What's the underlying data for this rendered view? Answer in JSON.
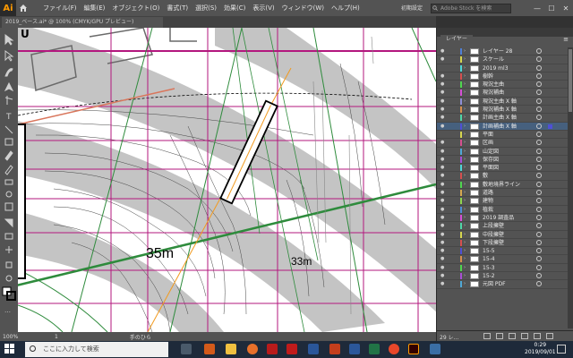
{
  "app": {
    "logo": "Ai",
    "home_icon": "home-icon"
  },
  "menu": {
    "items": [
      "ファイル(F)",
      "編集(E)",
      "オブジェクト(O)",
      "書式(T)",
      "選択(S)",
      "効果(C)",
      "表示(V)",
      "ウィンドウ(W)",
      "ヘルプ(H)"
    ],
    "workspace": "初期設定",
    "search_placeholder": "Adobe Stock を検索"
  },
  "document_tab": {
    "title": "2019_ベース.ai* @ 100% (CMYK/GPU プレビュー)"
  },
  "canvas": {
    "labels": {
      "contour_35": "35m",
      "contour_33": "33m",
      "top_mark": "U"
    },
    "colors": {
      "gray_band": "#c2c2c2",
      "magenta_guide": "#b3177e",
      "green_line": "#2e8b3c",
      "orange_line": "#f29a1e",
      "salmon_line": "#d9765c"
    }
  },
  "status": {
    "zoom": "100%",
    "artboard": "1",
    "tool": "手のひら"
  },
  "layers_panel": {
    "tab": "レイヤー",
    "menu_icon": "≡",
    "layer_count": "29 レ...",
    "layers": [
      {
        "name": "レイヤー 28",
        "color": "#4f7fd6",
        "visible": true,
        "selected": false
      },
      {
        "name": "スケール",
        "color": "#d6d64f",
        "visible": true,
        "selected": false
      },
      {
        "name": "2019 ml3",
        "color": "#4fd6d6",
        "visible": false,
        "selected": false
      },
      {
        "name": "樹幹",
        "color": "#d64f4f",
        "visible": true,
        "selected": false
      },
      {
        "name": "現況主曲",
        "color": "#4fd64f",
        "visible": true,
        "selected": false
      },
      {
        "name": "現況補曲",
        "color": "#d64fd6",
        "visible": true,
        "selected": false
      },
      {
        "name": "現況主曲 X 軸",
        "color": "#8f8fd6",
        "visible": true,
        "selected": false
      },
      {
        "name": "現況補曲 X 軸",
        "color": "#d68f4f",
        "visible": true,
        "selected": false
      },
      {
        "name": "計画主曲 X 軸",
        "color": "#4fd6a8",
        "visible": true,
        "selected": false
      },
      {
        "name": "計画補曲 X 軸",
        "color": "#4f4fd6",
        "visible": true,
        "selected": true
      },
      {
        "name": "平面",
        "color": "#d6d64f",
        "visible": false,
        "selected": false
      },
      {
        "name": "区画",
        "color": "#d64f8f",
        "visible": true,
        "selected": false
      },
      {
        "name": "山定図",
        "color": "#4fa8d6",
        "visible": true,
        "selected": false
      },
      {
        "name": "保存図",
        "color": "#a84fd6",
        "visible": true,
        "selected": false
      },
      {
        "name": "平面図",
        "color": "#4fd6d6",
        "visible": true,
        "selected": false
      },
      {
        "name": "敷",
        "color": "#d64f4f",
        "visible": true,
        "selected": false
      },
      {
        "name": "敷地境界ライン",
        "color": "#4fd64f",
        "visible": true,
        "selected": false
      },
      {
        "name": "道路",
        "color": "#d6a84f",
        "visible": true,
        "selected": false
      },
      {
        "name": "建物",
        "color": "#8fd64f",
        "visible": true,
        "selected": false
      },
      {
        "name": "植栽",
        "color": "#4f8fd6",
        "visible": true,
        "selected": false
      },
      {
        "name": "2019 調査品",
        "color": "#d64fd6",
        "visible": true,
        "selected": false
      },
      {
        "name": "上段擁壁",
        "color": "#4fd6a8",
        "visible": true,
        "selected": false
      },
      {
        "name": "中段擁壁",
        "color": "#d6d64f",
        "visible": true,
        "selected": false
      },
      {
        "name": "下段擁壁",
        "color": "#d64f4f",
        "visible": true,
        "selected": false
      },
      {
        "name": "15-5",
        "color": "#4f4fd6",
        "visible": true,
        "selected": false
      },
      {
        "name": "15-4",
        "color": "#d68f4f",
        "visible": true,
        "selected": false
      },
      {
        "name": "15-3",
        "color": "#4fd64f",
        "visible": true,
        "selected": false
      },
      {
        "name": "15-2",
        "color": "#a84fd6",
        "visible": true,
        "selected": false
      },
      {
        "name": "元図 PDF",
        "color": "#4fa8d6",
        "visible": true,
        "selected": false
      }
    ]
  },
  "taskbar": {
    "search_placeholder": "ここに入力して検索",
    "time": "0:29",
    "date": "2019/09/01"
  }
}
